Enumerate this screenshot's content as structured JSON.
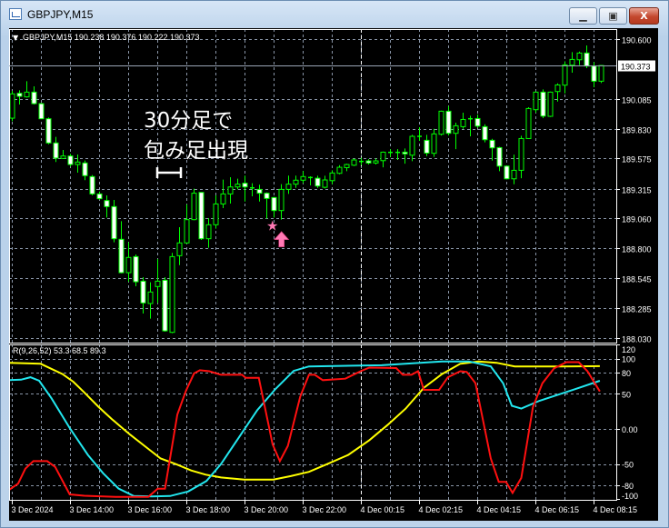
{
  "window": {
    "title": "GBPJPY,M15",
    "min_icon": "minimize-icon",
    "max_icon": "maximize-icon",
    "close_icon": "close-icon",
    "min_glyph": "▁",
    "max_glyph": "▣",
    "close_glyph": "X"
  },
  "chart_header": "GBPJPY,M15  190.238 190.376 190.222 190.373",
  "header_arrow": "▼",
  "annotation": {
    "line1": "30分足で",
    "line2": "包み足出現",
    "marker_star": "★"
  },
  "colors": {
    "bg": "#000000",
    "candle": "#00ff00",
    "grid": "#8a96a8",
    "yellow": "#ffff00",
    "cyan": "#22e6ee",
    "red": "#ff1010",
    "signal": "#ff79b4"
  },
  "chart_data": [
    {
      "type": "candlestick",
      "title": "GBPJPY,M15",
      "ohlc_legend": {
        "open": 190.238,
        "high": 190.376,
        "low": 190.222,
        "close": 190.373
      },
      "ylim": [
        188.03,
        190.6
      ],
      "price_ticks": [
        "190.600",
        "190.085",
        "189.830",
        "189.575",
        "189.315",
        "189.060",
        "188.800",
        "188.545",
        "188.285",
        "188.030"
      ],
      "current_price": "190.373",
      "time_labels": [
        {
          "i": 1,
          "label": "3 Dec 2024"
        },
        {
          "i": 9,
          "label": "3 Dec 14:00"
        },
        {
          "i": 17,
          "label": "3 Dec 16:00"
        },
        {
          "i": 25,
          "label": "3 Dec 18:00"
        },
        {
          "i": 33,
          "label": "3 Dec 20:00"
        },
        {
          "i": 41,
          "label": "3 Dec 22:00"
        },
        {
          "i": 49,
          "label": "4 Dec 00:15"
        },
        {
          "i": 57,
          "label": "4 Dec 02:15"
        },
        {
          "i": 65,
          "label": "4 Dec 04:15"
        },
        {
          "i": 73,
          "label": "4 Dec 06:15"
        },
        {
          "i": 81,
          "label": "4 Dec 08:15"
        }
      ],
      "day_separator_index": 49,
      "signal_index": 38,
      "candles_ohlc": [
        [
          189.92,
          190.155,
          189.894,
          190.129
        ],
        [
          190.134,
          190.16,
          190.038,
          190.108
        ],
        [
          190.103,
          190.238,
          190.097,
          190.144
        ],
        [
          190.144,
          190.194,
          190.038,
          190.045
        ],
        [
          190.045,
          190.051,
          189.915,
          189.915
        ],
        [
          189.915,
          189.926,
          189.696,
          189.707
        ],
        [
          189.707,
          189.759,
          189.543,
          189.577
        ],
        [
          189.574,
          189.647,
          189.569,
          189.595
        ],
        [
          189.595,
          189.613,
          189.504,
          189.522
        ],
        [
          189.522,
          189.608,
          189.452,
          189.543
        ],
        [
          189.535,
          189.556,
          189.387,
          189.426
        ],
        [
          189.418,
          189.431,
          189.256,
          189.269
        ],
        [
          189.269,
          189.29,
          189.217,
          189.228
        ],
        [
          189.212,
          189.256,
          189.066,
          189.16
        ],
        [
          189.16,
          189.217,
          188.853,
          188.884
        ],
        [
          188.879,
          189.035,
          188.587,
          188.592
        ],
        [
          188.592,
          188.853,
          188.514,
          188.723
        ],
        [
          188.73,
          188.749,
          188.475,
          188.514
        ],
        [
          188.519,
          188.553,
          188.241,
          188.332
        ],
        [
          188.327,
          188.509,
          188.197,
          188.426
        ],
        [
          188.473,
          188.71,
          188.332,
          188.519
        ],
        [
          188.527,
          188.553,
          188.085,
          188.092
        ],
        [
          188.079,
          188.762,
          188.072,
          188.73
        ],
        [
          188.738,
          188.983,
          188.657,
          188.848
        ],
        [
          188.848,
          189.178,
          188.84,
          189.048
        ],
        [
          189.048,
          189.314,
          189.043,
          189.275
        ],
        [
          189.282,
          189.282,
          188.874,
          188.884
        ],
        [
          188.884,
          189.061,
          188.806,
          189.004
        ],
        [
          189.004,
          189.256,
          188.97,
          189.183
        ],
        [
          189.183,
          189.392,
          189.147,
          189.269
        ],
        [
          189.269,
          189.413,
          189.186,
          189.329
        ],
        [
          189.329,
          189.4,
          189.308,
          189.353
        ],
        [
          189.361,
          189.426,
          189.204,
          189.329
        ],
        [
          189.316,
          189.361,
          189.249,
          189.321
        ],
        [
          189.308,
          189.348,
          189.204,
          189.275
        ],
        [
          189.275,
          189.282,
          189.056,
          189.23
        ],
        [
          189.238,
          189.243,
          189.066,
          189.126
        ],
        [
          189.126,
          189.353,
          189.048,
          189.308
        ],
        [
          189.308,
          189.426,
          189.269,
          189.353
        ],
        [
          189.353,
          189.426,
          189.321,
          189.387
        ],
        [
          189.387,
          189.465,
          189.361,
          189.418
        ],
        [
          189.41,
          189.42,
          189.342,
          189.41
        ],
        [
          189.404,
          189.425,
          189.321,
          189.337
        ],
        [
          189.326,
          189.425,
          189.316,
          189.389
        ],
        [
          189.383,
          189.472,
          189.352,
          189.449
        ],
        [
          189.446,
          189.516,
          189.438,
          189.498
        ],
        [
          189.495,
          189.529,
          189.464,
          189.522
        ],
        [
          189.516,
          189.574,
          189.508,
          189.561
        ],
        [
          189.548,
          189.581,
          189.516,
          189.548
        ],
        [
          189.553,
          189.568,
          189.522,
          189.535
        ],
        [
          189.535,
          189.574,
          189.522,
          189.553
        ],
        [
          189.555,
          189.633,
          189.498,
          189.628
        ],
        [
          189.626,
          189.654,
          189.587,
          189.626
        ],
        [
          189.626,
          189.654,
          189.561,
          189.626
        ],
        [
          189.628,
          189.66,
          189.529,
          189.613
        ],
        [
          189.602,
          189.777,
          189.55,
          189.764
        ],
        [
          189.764,
          189.842,
          189.725,
          189.764
        ],
        [
          189.73,
          189.777,
          189.594,
          189.62
        ],
        [
          189.618,
          189.829,
          189.587,
          189.785
        ],
        [
          189.782,
          189.985,
          189.771,
          189.98
        ],
        [
          189.98,
          190.024,
          189.771,
          189.79
        ],
        [
          189.79,
          189.881,
          189.654,
          189.855
        ],
        [
          189.847,
          189.967,
          189.829,
          189.909
        ],
        [
          189.915,
          189.941,
          189.764,
          189.915
        ],
        [
          189.917,
          189.951,
          189.837,
          189.852
        ],
        [
          189.847,
          189.868,
          189.712,
          189.735
        ],
        [
          189.73,
          189.743,
          189.555,
          189.665
        ],
        [
          189.667,
          189.673,
          189.464,
          189.508
        ],
        [
          189.508,
          189.508,
          189.394,
          189.399
        ],
        [
          189.399,
          189.607,
          189.352,
          189.472
        ],
        [
          189.472,
          189.769,
          189.404,
          189.745
        ],
        [
          189.745,
          190.014,
          189.745,
          190.003
        ],
        [
          189.993,
          190.149,
          189.967,
          190.144
        ],
        [
          190.144,
          190.167,
          189.92,
          189.938
        ],
        [
          189.936,
          190.149,
          189.93,
          190.144
        ],
        [
          190.149,
          190.219,
          190.063,
          190.206
        ],
        [
          190.204,
          190.409,
          190.133,
          190.378
        ],
        [
          190.376,
          190.488,
          190.311,
          190.425
        ],
        [
          190.422,
          190.493,
          190.376,
          190.48
        ],
        [
          190.48,
          190.545,
          190.35,
          190.368
        ],
        [
          190.368,
          190.402,
          190.186,
          190.238
        ],
        [
          190.238,
          190.376,
          190.222,
          190.373
        ]
      ]
    },
    {
      "type": "line",
      "title": "R(9,26,52) 53.3 68.5 89.3",
      "ylim": [
        -100,
        120
      ],
      "y_ticks": [
        "120",
        "100",
        "80",
        "50",
        "0.00",
        "-50",
        "-80",
        "-100"
      ],
      "y_tick_values": [
        120,
        100,
        80,
        50,
        0,
        -50,
        -80,
        -100
      ],
      "grid_values": [
        100,
        80,
        50,
        0,
        -50,
        -80
      ],
      "series": [
        {
          "name": "R(52)",
          "color": "#ffff00",
          "last": 89.3,
          "points": [
            [
              0.7,
              94
            ],
            [
              5,
              92.6
            ],
            [
              8,
              78
            ],
            [
              9.5,
              67
            ],
            [
              11,
              52
            ],
            [
              13,
              31
            ],
            [
              14.8,
              14
            ],
            [
              17.3,
              -8
            ],
            [
              19.4,
              -25
            ],
            [
              21.5,
              -42
            ],
            [
              23.6,
              -50
            ],
            [
              25.7,
              -59
            ],
            [
              27.7,
              -65
            ],
            [
              29.8,
              -69
            ],
            [
              33,
              -72
            ],
            [
              37,
              -72
            ],
            [
              39.4,
              -67
            ],
            [
              41.9,
              -61
            ],
            [
              44.4,
              -50
            ],
            [
              47.3,
              -37
            ],
            [
              50.2,
              -16
            ],
            [
              52.7,
              5.5
            ],
            [
              55.2,
              29
            ],
            [
              57.7,
              58.5
            ],
            [
              60.2,
              78
            ],
            [
              62.7,
              92.6
            ],
            [
              65.2,
              96
            ],
            [
              67.7,
              94
            ],
            [
              70.2,
              88.9
            ],
            [
              76.5,
              88.9
            ],
            [
              81.9,
              89.3
            ]
          ]
        },
        {
          "name": "R(26)",
          "color": "#22e6ee",
          "last": 68.5,
          "points": [
            [
              0.7,
              69.4
            ],
            [
              2.3,
              70
            ],
            [
              3.6,
              73.5
            ],
            [
              4.8,
              68.5
            ],
            [
              6.5,
              43.6
            ],
            [
              9,
              1.3
            ],
            [
              11.5,
              -37
            ],
            [
              13.6,
              -63
            ],
            [
              15.7,
              -84.6
            ],
            [
              17.8,
              -95.3
            ],
            [
              20.3,
              -96
            ],
            [
              22.8,
              -95.3
            ],
            [
              25.3,
              -88.9
            ],
            [
              27.8,
              -74
            ],
            [
              29.8,
              -50
            ],
            [
              32.3,
              -11.5
            ],
            [
              34.8,
              26.9
            ],
            [
              37.3,
              56.8
            ],
            [
              39.8,
              82.5
            ],
            [
              41.9,
              88.9
            ],
            [
              51.9,
              90.6
            ],
            [
              60.2,
              96
            ],
            [
              63.9,
              96
            ],
            [
              66.9,
              89
            ],
            [
              68.6,
              65
            ],
            [
              69.8,
              33
            ],
            [
              71.1,
              29
            ],
            [
              73.6,
              40
            ],
            [
              78.6,
              57
            ],
            [
              81.9,
              68.5
            ]
          ]
        },
        {
          "name": "R(9)",
          "color": "#ff1010",
          "last": 53.3,
          "points": [
            [
              0.7,
              -86.3
            ],
            [
              1.9,
              -77.8
            ],
            [
              2.9,
              -56.4
            ],
            [
              4,
              -45.7
            ],
            [
              5.9,
              -45.7
            ],
            [
              7,
              -54
            ],
            [
              9,
              -93
            ],
            [
              11,
              -95
            ],
            [
              15.3,
              -96.6
            ],
            [
              19.8,
              -96.6
            ],
            [
              21.1,
              -85
            ],
            [
              22.1,
              -85
            ],
            [
              23.8,
              20.5
            ],
            [
              25,
              54.7
            ],
            [
              26.1,
              79
            ],
            [
              26.9,
              83.4
            ],
            [
              28.2,
              82
            ],
            [
              29.8,
              77
            ],
            [
              32.7,
              77
            ],
            [
              33.2,
              72.6
            ],
            [
              35,
              72.6
            ],
            [
              36.9,
              -22
            ],
            [
              37.9,
              -45.7
            ],
            [
              39,
              -24
            ],
            [
              40.7,
              46
            ],
            [
              41.9,
              77
            ],
            [
              42.7,
              77
            ],
            [
              43.8,
              69.4
            ],
            [
              46.9,
              71.4
            ],
            [
              49,
              82
            ],
            [
              50.2,
              87.2
            ],
            [
              53.9,
              86.5
            ],
            [
              54.8,
              77
            ],
            [
              56,
              77
            ],
            [
              56.9,
              82
            ],
            [
              57.7,
              55.6
            ],
            [
              59.8,
              55.6
            ],
            [
              61,
              73.5
            ],
            [
              62.7,
              82
            ],
            [
              63.6,
              81
            ],
            [
              64.8,
              65
            ],
            [
              66.9,
              -41.9
            ],
            [
              68,
              -75.2
            ],
            [
              69,
              -75.2
            ],
            [
              69.9,
              -91
            ],
            [
              71.1,
              -69.7
            ],
            [
              72.7,
              31
            ],
            [
              74,
              65
            ],
            [
              75.6,
              86
            ],
            [
              77.3,
              95
            ],
            [
              79,
              95
            ],
            [
              80.2,
              82
            ],
            [
              81.9,
              53.3
            ]
          ]
        }
      ]
    }
  ]
}
